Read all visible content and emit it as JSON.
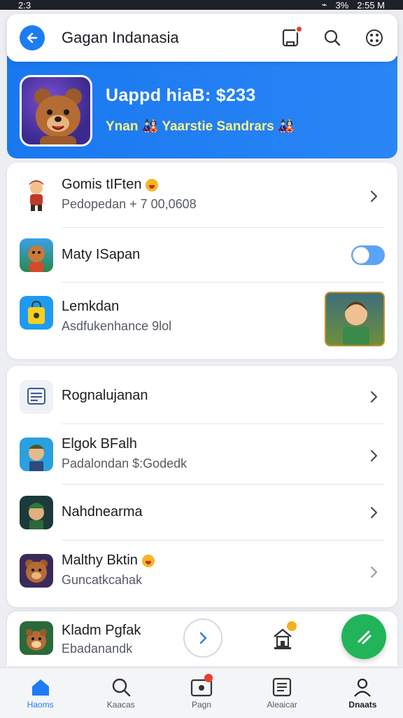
{
  "status_bar": {
    "time_left": "2:3",
    "battery": "3%",
    "time_right": "2:55 M"
  },
  "header": {
    "title": "Gagan Indanasia"
  },
  "banner": {
    "title": "Uappd hiaB: $233",
    "subtitle": "Ynan 🎎 Yaarstie Sandrars 🎎"
  },
  "card1": {
    "items": [
      {
        "title": "Gomis tIFten",
        "subtitle": "Pedopedan + 7 00,0608"
      },
      {
        "title": "Maty ISapan"
      },
      {
        "title": "Lemkdan",
        "subtitle": "Asdfukenhance 9lol"
      }
    ]
  },
  "card2": {
    "items": [
      {
        "title": "Rognalujanan"
      },
      {
        "title": "Elgok BFalh",
        "subtitle": "Padalondan $:Godedk"
      },
      {
        "title": "Nahdnearma"
      },
      {
        "title": "Malthy Bktin",
        "subtitle": "Guncatkcahak"
      }
    ]
  },
  "footer_item": {
    "title": "Kladm Pgfak",
    "subtitle": "Ebadanandk"
  },
  "bottom_nav": {
    "items": [
      {
        "label": "Haoms"
      },
      {
        "label": "Kaacas"
      },
      {
        "label": "Pagn"
      },
      {
        "label": "Aleaicar"
      },
      {
        "label": "Dnaats"
      }
    ]
  },
  "colors": {
    "accent": "#1e7cf2",
    "banner": "#2684f5",
    "fab": "#22b45a",
    "badge": "#ef3b30"
  }
}
